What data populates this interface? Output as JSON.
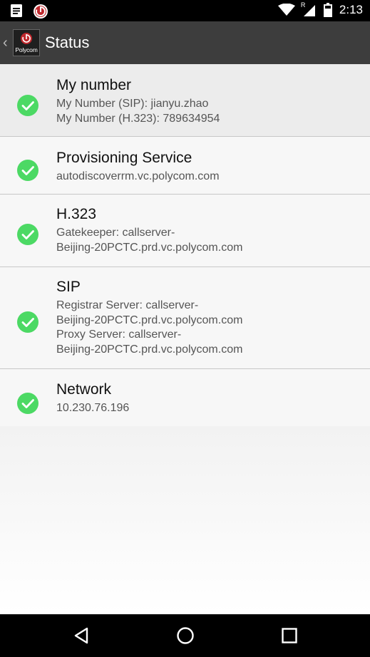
{
  "status_bar": {
    "time": "2:13",
    "left_icons": [
      "notification-doc-icon",
      "polycom-notification-icon"
    ],
    "right_icons": [
      "wifi-icon",
      "cellular-roaming-icon",
      "battery-icon"
    ],
    "roaming_label": "R"
  },
  "app_bar": {
    "back_icon": "chevron-left-icon",
    "logo_text": "Polycom",
    "title": "Status"
  },
  "items": [
    {
      "title": "My number",
      "lines": [
        "My Number (SIP): jianyu.zhao",
        "My Number (H.323): 789634954"
      ],
      "status_icon": "check-circle-icon"
    },
    {
      "title": "Provisioning Service",
      "lines": [
        "autodiscoverrm.vc.polycom.com"
      ],
      "status_icon": "check-circle-icon"
    },
    {
      "title": "H.323",
      "lines": [
        "Gatekeeper: callserver-",
        "Beijing-20PCTC.prd.vc.polycom.com"
      ],
      "status_icon": "check-circle-icon"
    },
    {
      "title": "SIP",
      "lines": [
        "Registrar Server: callserver-",
        "Beijing-20PCTC.prd.vc.polycom.com",
        "Proxy Server: callserver-",
        "Beijing-20PCTC.prd.vc.polycom.com"
      ],
      "status_icon": "check-circle-icon"
    },
    {
      "title": "Network",
      "lines": [
        "10.230.76.196"
      ],
      "status_icon": "check-circle-icon"
    }
  ],
  "nav_bar": {
    "buttons": [
      "back-triangle-icon",
      "home-circle-icon",
      "recents-square-icon"
    ]
  },
  "colors": {
    "status_ok": "#4cd964",
    "app_bar": "#3d3d3d",
    "status_bar": "#000000"
  }
}
